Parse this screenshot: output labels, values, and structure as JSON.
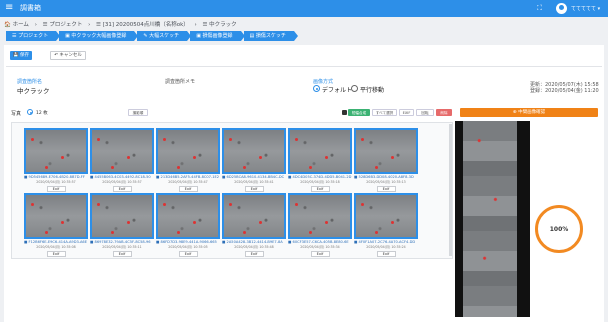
{
  "app": {
    "title": "調書箱",
    "menu_icon": "≡",
    "expand_icon": "⛶",
    "user": "ててててて ▾"
  },
  "breadcrumb": [
    "🏠 ホーム",
    "›",
    "☰ プロジェクト",
    "›",
    "☰ [31] 20200504点川橋（名称ok）",
    "›",
    "☰ 中クラック"
  ],
  "steps": [
    "☰ プロジェクト",
    "▣ 中クラック大幅画像登録",
    "✎ 大幅スケッチ",
    "▣ 損傷画像登録",
    "▤ 損傷スケッチ"
  ],
  "toolbar": {
    "save_label": "💾 保存",
    "cancel_label": "↶ キャンセル"
  },
  "form": {
    "name_label": "調査箇所名",
    "name_value": "中クラック",
    "memo_label": "調査箇所メモ",
    "method_label": "画像方式",
    "option_default": "デフォルト",
    "option_parallel": "平行移動",
    "updated": "更新：2020/05/07(木) 15:58",
    "registered": "登録：2020/05/04(金) 11:20"
  },
  "photos": {
    "label": "写真",
    "count": "12 枚",
    "sort_label": "撮影順",
    "btn_panorama": "短幅合成",
    "btn_select_all": "すべて選択",
    "btn_exif": "EXIF",
    "btn_rotate": "回転",
    "btn_delete": "削除",
    "items": [
      {
        "name": "■ 9D545689-E706-4B20-8B7D-FF",
        "date": "2020/05/04(月) 10:35:57",
        "exif": "Exif"
      },
      {
        "name": "■ 4455B063-4C03-4492-8C18-50",
        "date": "2020/05/04(月) 10:35:57",
        "exif": "Exif"
      },
      {
        "name": "■ 213D46B5-2AF5-44FB-8C07-1E2",
        "date": "2020/05/04(月) 10:35:47",
        "exif": "Exif"
      },
      {
        "name": "■ 6D25BCA8-9610-4134-BB4C-DC",
        "date": "2020/05/04(月) 10:35:41",
        "exif": "Exif"
      },
      {
        "name": "■ 4DC4D05C-374D-4DD5-B041-2D",
        "date": "2020/05/04(月) 10:35:18",
        "exif": "Exif"
      },
      {
        "name": "■ 528D6B3-DD08-4020-A8F8-3D",
        "date": "2020/05/04(月) 10:35:13",
        "exif": "Exif"
      },
      {
        "name": "■ F12B6F6E-E9C6-414A-A9D3-A6E",
        "date": "2020/05/04(月) 10:35:08",
        "exif": "Exif"
      },
      {
        "name": "■ 86978E32-79AB-4C5F-8C58-96",
        "date": "2020/05/04(月) 10:35:11",
        "exif": "Exif"
      },
      {
        "name": "■ 86FD7D3-98E9-441A-9066-665",
        "date": "2020/05/04(月) 10:35:05",
        "exif": "Exif"
      },
      {
        "name": "■ 2A50A428-3B12-4414-B9E7-8A",
        "date": "2020/05/04(月) 10:35:48",
        "exif": "Exif"
      },
      {
        "name": "■ 60CF3E57-C6CA-405B-8E80-6E",
        "date": "2020/05/04(月) 10:35:34",
        "exif": "Exif"
      },
      {
        "name": "■ 4F0F1A07-2C76-4A70-ACF4-DD",
        "date": "2020/05/04(月) 10:35:24",
        "exif": "Exif"
      }
    ]
  },
  "preview": {
    "button": "⊕ 中間画像確認",
    "progress_text": "100%",
    "progress": 1.0
  },
  "colors": {
    "accent": "#2d8fe8",
    "orange": "#f08216",
    "danger": "#e66a6a",
    "success": "#3bb273"
  }
}
